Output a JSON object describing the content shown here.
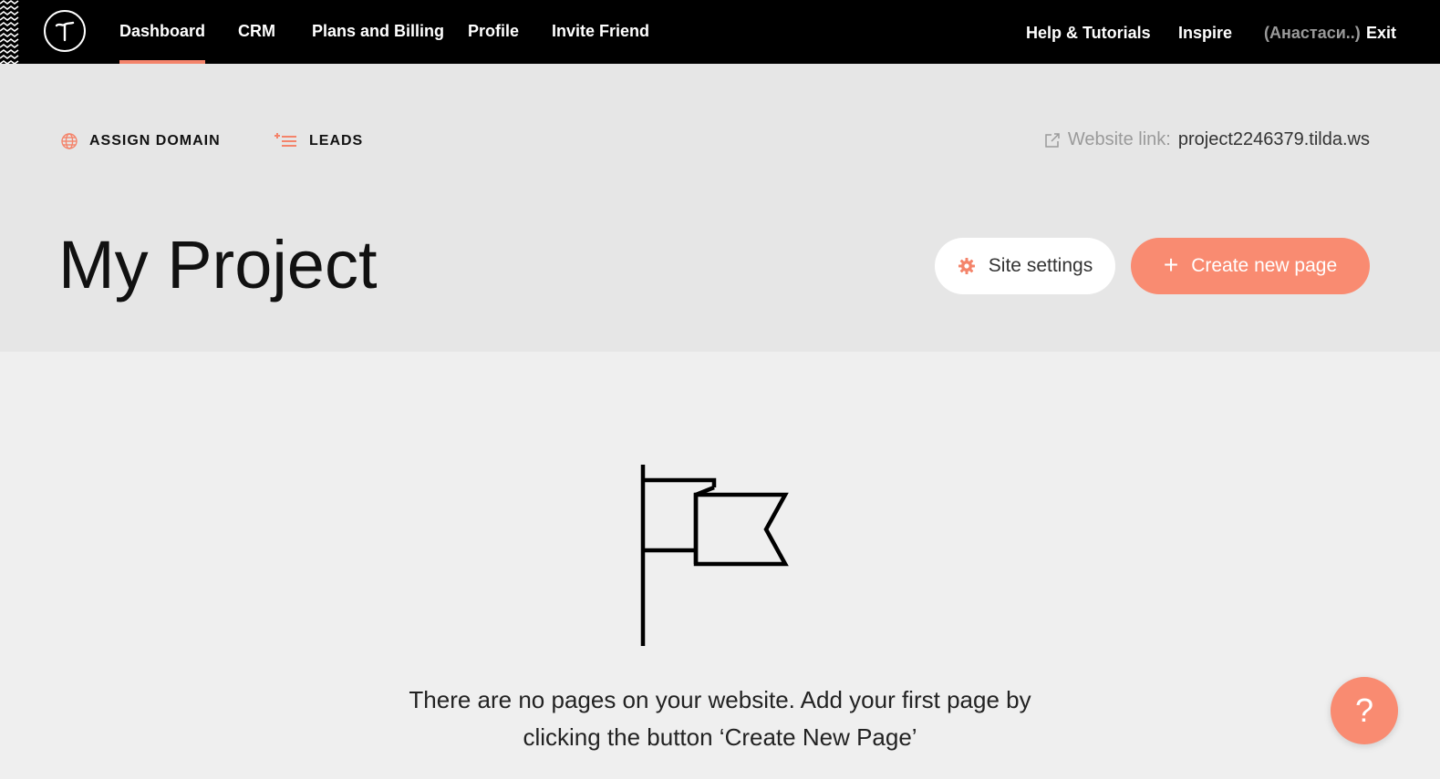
{
  "nav": {
    "items": [
      {
        "label": "Dashboard",
        "active": true
      },
      {
        "label": "CRM"
      },
      {
        "label": "Plans and Billing"
      },
      {
        "label": "Profile"
      },
      {
        "label": "Invite Friend"
      }
    ],
    "help_label": "Help & Tutorials",
    "inspire_label": "Inspire",
    "user_label": "(Анастаси..)",
    "exit_label": "Exit",
    "logo_icon": "tilda-t-logo",
    "accent_color": "#f4846b"
  },
  "toolbar": {
    "assign_domain_label": "ASSIGN DOMAIN",
    "assign_domain_icon": "globe-icon",
    "leads_label": "LEADS",
    "leads_icon": "add-list-icon",
    "website_link_label": "Website link:",
    "website_link_url": "project2246379.tilda.ws",
    "external_link_icon": "external-link-icon"
  },
  "project": {
    "title": "My Project",
    "site_settings_label": "Site settings",
    "site_settings_icon": "gear-icon",
    "create_page_label": "Create new page",
    "create_page_icon": "plus-icon",
    "button_color": "#f98b71"
  },
  "empty_state": {
    "icon": "flag-icon",
    "line1": "There are no pages on your website. Add your first page by",
    "line2": "clicking the button ‘Create New Page’"
  },
  "help_button": {
    "label": "?",
    "icon": "question-icon"
  }
}
